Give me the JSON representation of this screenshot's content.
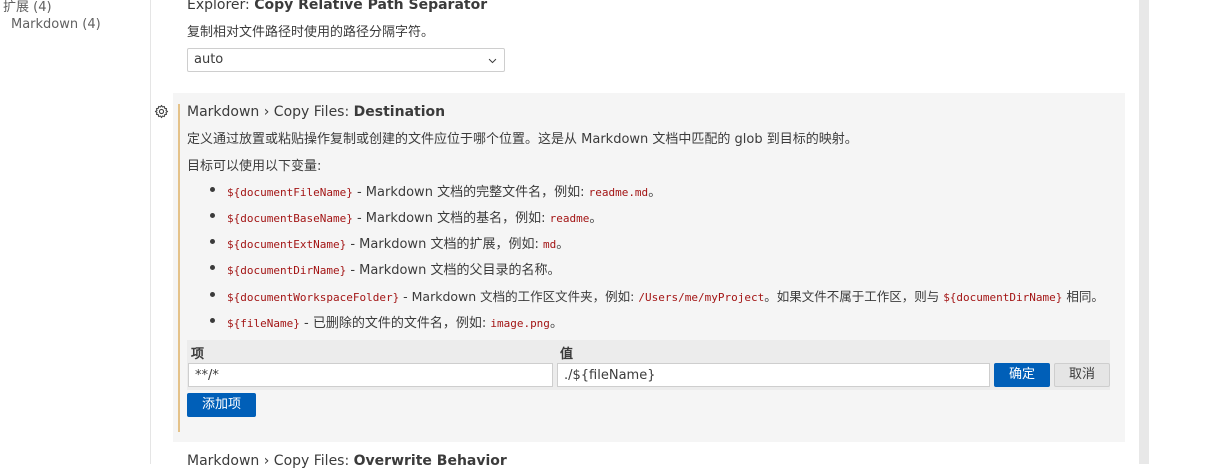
{
  "toc": {
    "extensions": "扩展 (4)",
    "markdown": "Markdown (4)"
  },
  "explorer_setting": {
    "category": "Explorer: ",
    "name": "Copy Relative Path Separator",
    "description": "复制相对文件路径时使用的路径分隔字符。",
    "selected_value": "auto"
  },
  "destination_setting": {
    "category": "Markdown › Copy Files: ",
    "name": "Destination",
    "description": "定义通过放置或粘贴操作复制或创建的文件应位于哪个位置。这是从 Markdown 文档中匹配的 glob 到目标的映射。",
    "vars_intro": "目标可以使用以下变量:",
    "variables": [
      {
        "code": "${documentFileName}",
        "text": " - Markdown 文档的完整文件名，例如: ",
        "example": "readme.md",
        "tail": "。"
      },
      {
        "code": "${documentBaseName}",
        "text": " - Markdown 文档的基名，例如: ",
        "example": "readme",
        "tail": "。"
      },
      {
        "code": "${documentExtName}",
        "text": " - Markdown 文档的扩展，例如: ",
        "example": "md",
        "tail": "。"
      },
      {
        "code": "${documentDirName}",
        "text": " - Markdown 文档的父目录的名称。",
        "example": "",
        "tail": ""
      },
      {
        "code": "${documentWorkspaceFolder}",
        "text": " - Markdown 文档的工作区文件夹，例如: ",
        "example": "/Users/me/myProject",
        "tail": "。如果文件不属于工作区，则与 ",
        "code2": "${documentDirName}",
        "tail2": " 相同。"
      },
      {
        "code": "${fileName}",
        "text": " - 已删除的文件的文件名，例如: ",
        "example": "image.png",
        "tail": "。"
      }
    ],
    "table": {
      "key_header": "项",
      "value_header": "值",
      "key_value": "**/*",
      "value_value": "./${fileName}",
      "ok_label": "确定",
      "cancel_label": "取消"
    },
    "add_item_label": "添加项"
  },
  "next_setting": {
    "category": "Markdown › Copy Files: ",
    "name": "Overwrite Behavior"
  },
  "colors": {
    "accent": "#005fb8",
    "code": "#a31515",
    "focus_bar": "#e4c28a"
  },
  "icons": {
    "gear": "gear-icon",
    "chevron": "chevron-down-icon"
  }
}
